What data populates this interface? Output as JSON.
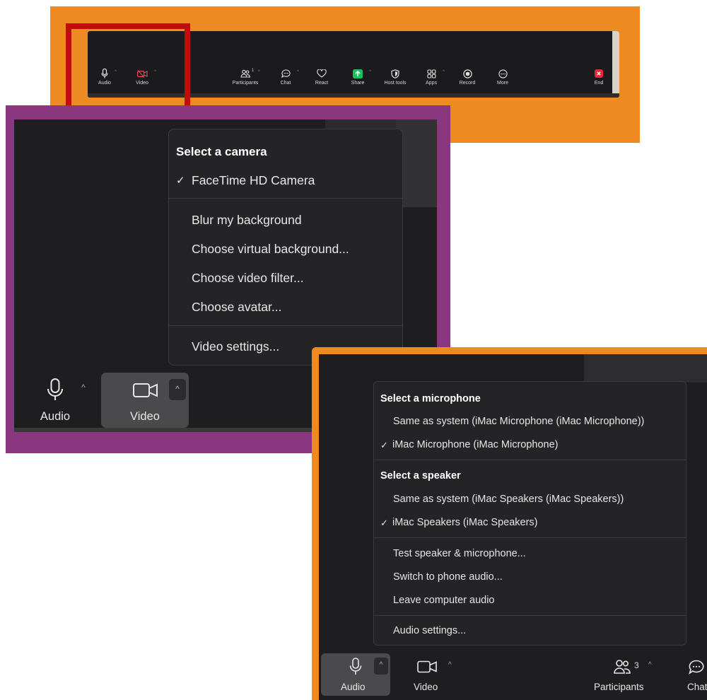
{
  "top_toolbar": {
    "audio_label": "Audio",
    "video_label": "Video",
    "participants_label": "Participants",
    "participants_count": "1",
    "chat_label": "Chat",
    "react_label": "React",
    "share_label": "Share",
    "host_tools_label": "Host tools",
    "apps_label": "Apps",
    "record_label": "Record",
    "more_label": "More",
    "end_label": "End"
  },
  "camera_menu": {
    "header": "Select a camera",
    "selected_camera": "FaceTime HD Camera",
    "items": [
      "Blur my background",
      "Choose virtual background...",
      "Choose video filter...",
      "Choose avatar..."
    ],
    "settings": "Video settings..."
  },
  "camera_toolbar": {
    "audio_label": "Audio",
    "video_label": "Video"
  },
  "audio_menu": {
    "mic_header": "Select a microphone",
    "mic_options": [
      "Same as system (iMac Microphone (iMac Microphone))",
      "iMac Microphone (iMac Microphone)"
    ],
    "speaker_header": "Select a speaker",
    "speaker_options": [
      "Same as system (iMac Speakers (iMac Speakers))",
      "iMac Speakers (iMac Speakers)"
    ],
    "actions": [
      "Test speaker & microphone...",
      "Switch to phone audio...",
      "Leave computer audio"
    ],
    "settings": "Audio settings..."
  },
  "audio_toolbar": {
    "audio_label": "Audio",
    "video_label": "Video",
    "participants_label": "Participants",
    "participants_count": "3",
    "chat_label": "Chat"
  },
  "colors": {
    "frame_orange": "#ee8a22",
    "frame_purple": "#8a3780",
    "highlight_red": "#c20b0b",
    "toolbar_bg": "#1b1b1d",
    "share_green": "#1fbe5b",
    "end_red": "#e5293b",
    "video_off_red": "#e5484d"
  },
  "icons": {
    "audio": "microphone-icon",
    "video": "video-camera-icon",
    "participants": "people-icon",
    "chat": "chat-bubble-icon",
    "react": "heart-icon",
    "share": "share-arrow-icon",
    "host_tools": "shield-icon",
    "apps": "apps-icon",
    "record": "record-icon",
    "more": "more-dots-icon",
    "end": "end-x-icon",
    "check": "checkmark-icon",
    "caret": "chevron-up-icon"
  }
}
